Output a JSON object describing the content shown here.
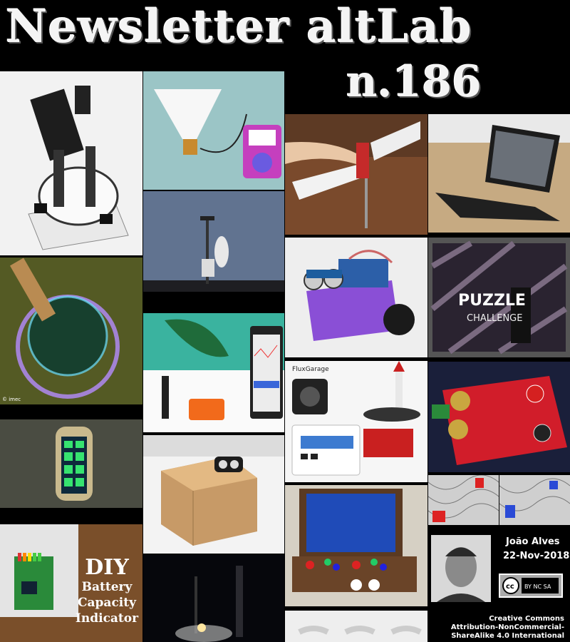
{
  "header": {
    "title": "Newsletter altLab",
    "issue": "n.186"
  },
  "tiles": {
    "imec_label": "© imec",
    "fluxgarage_label": "FluxGarage",
    "puzzle_word": "PUZZLE",
    "puzzle_sub": "CHALLENGE",
    "diy": {
      "line1": "DIY",
      "line2": "Battery",
      "line3": "Capacity",
      "line4": "Indicator"
    }
  },
  "author": {
    "name": "João Alves",
    "date": "22-Nov-2018",
    "cc_badge_text": "BY NC SA"
  },
  "license": {
    "line1": "Creative Commons",
    "line2": "Attribution-NonCommercial-",
    "line3": "ShareAlike 4.0 International"
  },
  "colors": {
    "background": "#000000",
    "text": "#ffffff",
    "purple_robot": "#8a4fd6",
    "red_board": "#d11d2a",
    "sky": "#5d6f8a"
  }
}
